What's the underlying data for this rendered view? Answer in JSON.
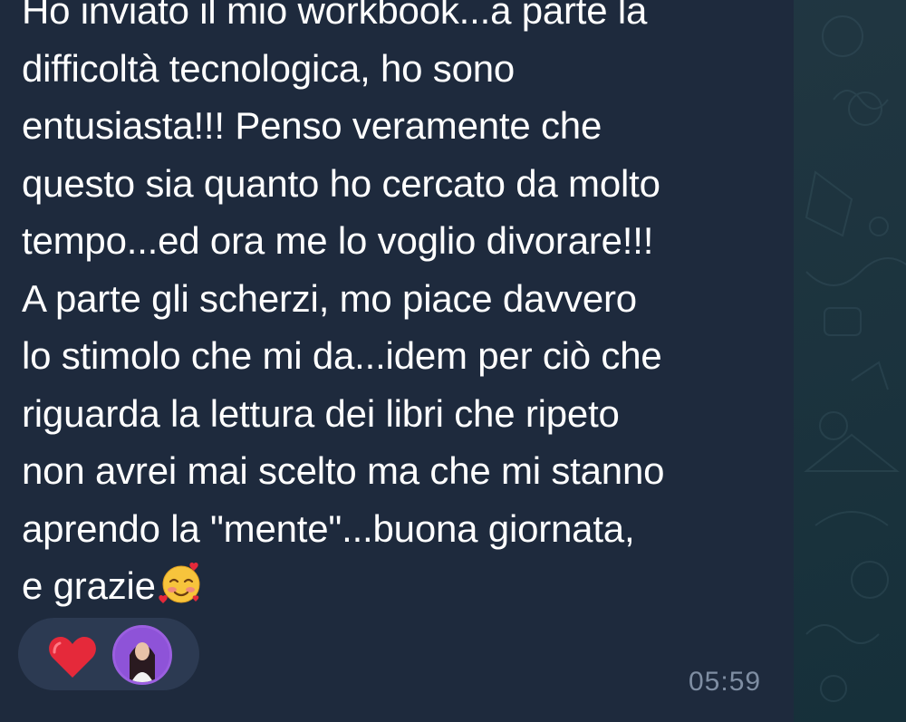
{
  "message": {
    "lines": [
      "Ho inviato il mio workbook...a parte la",
      "difficoltà tecnologica, ho sono",
      "entusiasta!!! Penso veramente che",
      "questo sia quanto ho cercato da molto",
      "tempo...ed ora me lo voglio divorare!!!",
      "A parte gli scherzi, mo piace davvero",
      "lo stimolo che mi da...idem per ciò che",
      "riguarda la lettura dei libri che ripeto",
      "non avrei mai scelto ma che mi stanno",
      "aprendo la \"mente\"...buona giornata,",
      "e grazie"
    ],
    "emoji": "smiling-face-with-hearts",
    "time": "05:59"
  },
  "reactions": {
    "emoji": "heart",
    "reactor": "avatar"
  },
  "colors": {
    "bubble": "#1e2a3d",
    "text": "#ffffff",
    "timestamp": "#7f8ea3",
    "reaction_pill": "#2c3a52",
    "heart": "#e5293a",
    "avatar_ring": "#9b5fe0"
  }
}
